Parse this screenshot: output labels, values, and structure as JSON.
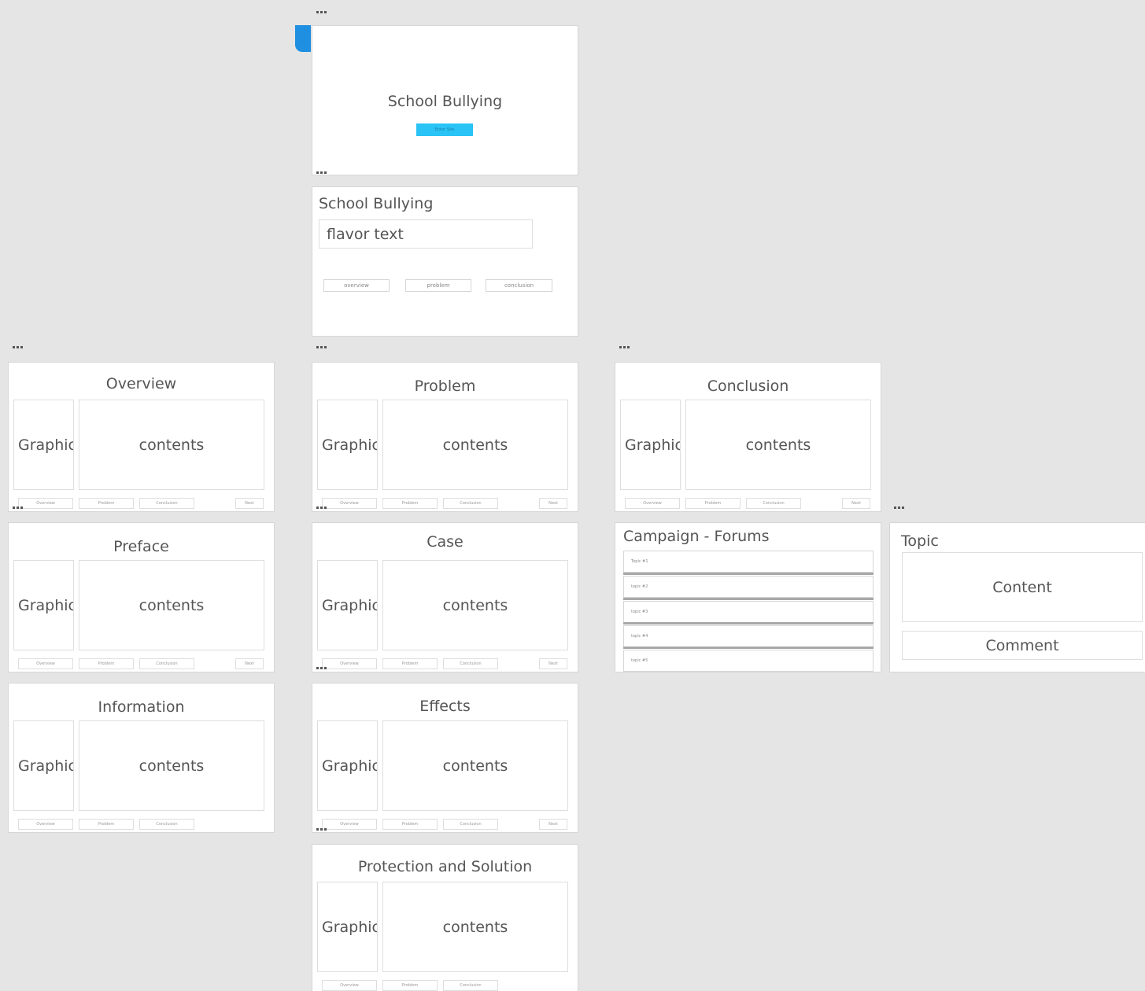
{
  "canvas": {
    "background": "#e5e5e5",
    "accent": "#1e8fe1",
    "cta": "#29c3f5"
  },
  "splash": {
    "title": "School Bullying",
    "button_label": "Enter Site"
  },
  "home": {
    "title": "School Bullying",
    "flavor_text": "flavor text",
    "nav": [
      "overview",
      "problem",
      "conclusion"
    ]
  },
  "section_labels": {
    "graphic": "Graphic",
    "contents": "contents"
  },
  "mini_nav": {
    "overview": "Overview",
    "problem": "Problem",
    "conclusion": "Conclusion",
    "next": "Next"
  },
  "sections": {
    "overview": "Overview",
    "preface": "Preface",
    "information": "Information",
    "problem": "Problem",
    "case": "Case",
    "effects": "Effects",
    "protection": "Protection and Solution",
    "conclusion": "Conclusion"
  },
  "forums": {
    "title": "Campaign - Forums",
    "topics": [
      "Topic #1",
      "topic #2",
      "topic #3",
      "topic #4",
      "topic #5"
    ]
  },
  "topic": {
    "title": "Topic",
    "content": "Content",
    "comment": "Comment"
  }
}
